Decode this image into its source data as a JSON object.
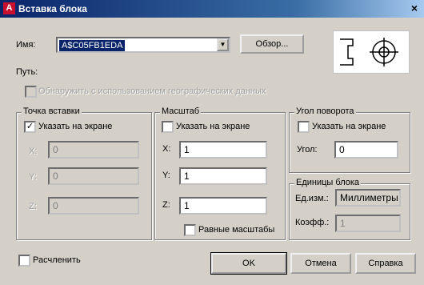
{
  "title": "Вставка блока",
  "close_glyph": "×",
  "name_label": "Имя:",
  "name_value": "A$C05FB1EDA",
  "browse_button": "Обзор...",
  "path_label": "Путь:",
  "geo_checkbox_label": "Обнаружить с использованием географических данных",
  "insertion": {
    "caption": "Точка вставки",
    "specify_on_screen": "Указать на экране",
    "specify_checked": true,
    "x_label": "X:",
    "y_label": "Y:",
    "z_label": "Z:",
    "x": "0",
    "y": "0",
    "z": "0"
  },
  "scale": {
    "caption": "Масштаб",
    "specify_on_screen": "Указать на экране",
    "specify_checked": false,
    "x_label": "X:",
    "y_label": "Y:",
    "z_label": "Z:",
    "x": "1",
    "y": "1",
    "z": "1",
    "uniform_label": "Равные масштабы"
  },
  "rotation": {
    "caption": "Угол поворота",
    "specify_on_screen": "Указать на экране",
    "angle_label": "Угол:",
    "angle": "0"
  },
  "units": {
    "caption": "Единицы блока",
    "unit_label": "Ед.изм.:",
    "unit_value": "Миллиметры",
    "factor_label": "Коэфф.:",
    "factor_value": "1"
  },
  "explode_label": "Расчленить",
  "ok_button": "OK",
  "cancel_button": "Отмена",
  "help_button": "Справка",
  "app_icon_letter": "A",
  "check_glyph": "✓",
  "dropdown_glyph": "▼"
}
